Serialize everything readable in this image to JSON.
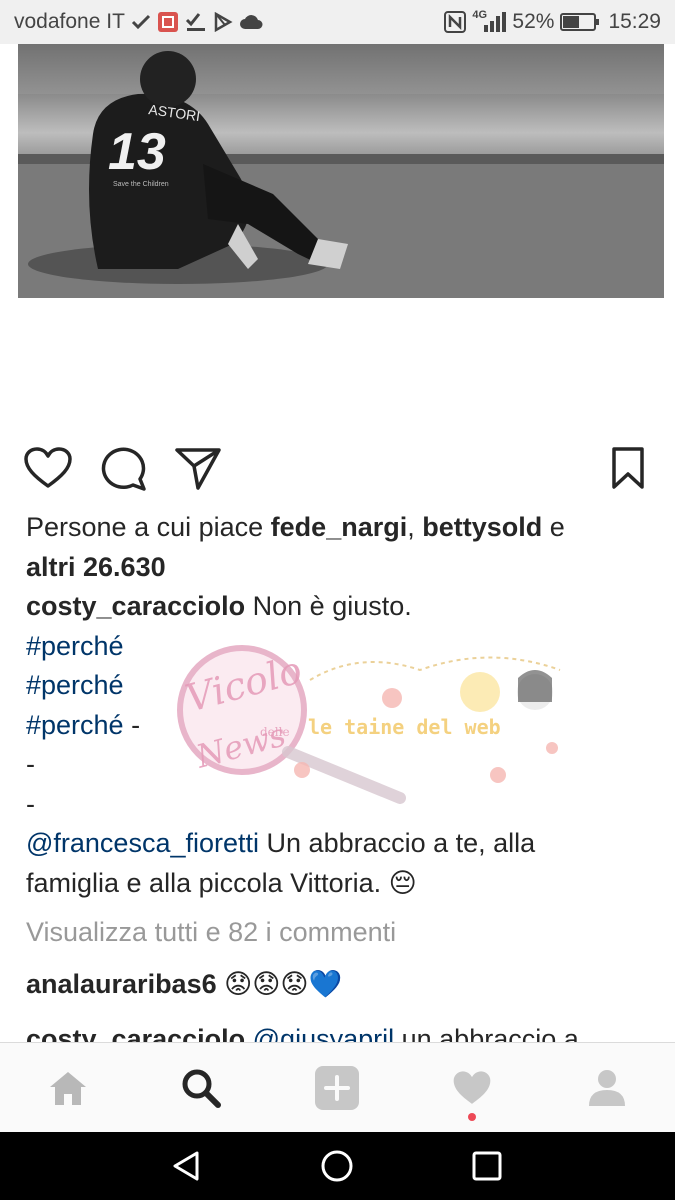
{
  "status_bar": {
    "carrier": "vodafone IT",
    "network": "4G",
    "battery": "52%",
    "battery_level": 0.52,
    "time": "15:29",
    "icons": [
      "check-icon",
      "notification-app-icon",
      "checklist-icon",
      "play-store-icon",
      "cloud-icon",
      "nfc-icon",
      "signal-icon",
      "battery-icon"
    ]
  },
  "post": {
    "jersey_name": "ASTORI",
    "jersey_number": "13",
    "jersey_sponsor": "Save the Children"
  },
  "actions": {
    "like": "heart-icon",
    "comment": "comment-icon",
    "share": "send-icon",
    "save": "bookmark-icon"
  },
  "likes": {
    "prefix": "Persone a cui piace",
    "user1": "fede_nargi",
    "separator": ",",
    "user2": "bettysold",
    "conjunction": "e",
    "others": "altri 26.630"
  },
  "caption": {
    "author": "costy_caracciolo",
    "text": "Non è giusto.",
    "hashtags": [
      "#perché",
      "#perché",
      "#perché"
    ],
    "after_third": "-",
    "dash_lines": [
      "-",
      "-"
    ],
    "mention": "@francesca_fioretti",
    "mention_text_1": "Un abbraccio a te, alla",
    "mention_text_2": "famiglia e alla piccola Vittoria. 😔"
  },
  "view_all": "Visualizza tutti e 82 i commenti",
  "comments": [
    {
      "user": "analauraribas6",
      "text": "😟😟😟💙"
    },
    {
      "user": "costy_caracciolo",
      "mention": "@giusyapril",
      "text": "un abbraccio a"
    }
  ],
  "watermark": {
    "title": "Vicolo",
    "small": "delle",
    "word": "News",
    "tagline": "le taine del web"
  },
  "bottom_nav": [
    "home-icon",
    "search-icon",
    "add-icon",
    "heart-icon",
    "profile-icon"
  ],
  "colors": {
    "link": "#003569",
    "muted": "#999999",
    "text": "#262626",
    "notification": "#ed4956"
  }
}
